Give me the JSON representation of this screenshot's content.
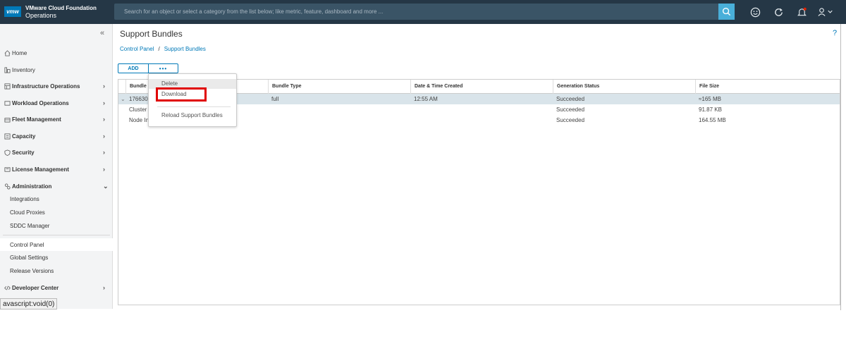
{
  "header": {
    "logo_text": "vmw",
    "brand_line1": "VMware Cloud Foundation",
    "brand_line2": "Operations",
    "search_placeholder": "Search for an object or select a category from the list below; like metric, feature, dashboard and more ...",
    "bg_color": "#253746",
    "accent_color": "#49afd9",
    "icons": [
      "search-icon",
      "smiley-icon",
      "refresh-icon",
      "bell-icon",
      "user-icon"
    ]
  },
  "sidebar": {
    "collapse_glyph": "«",
    "items": [
      {
        "label": "Home",
        "icon": "home-icon",
        "bold": false,
        "chevron": ""
      },
      {
        "label": "Inventory",
        "icon": "inventory-icon",
        "bold": false,
        "chevron": ""
      },
      {
        "label": "Infrastructure Operations",
        "icon": "infrastructure-icon",
        "bold": true,
        "chevron": "›"
      },
      {
        "label": "Workload Operations",
        "icon": "workload-icon",
        "bold": true,
        "chevron": "›"
      },
      {
        "label": "Fleet Management",
        "icon": "fleet-icon",
        "bold": true,
        "chevron": "›"
      },
      {
        "label": "Capacity",
        "icon": "capacity-icon",
        "bold": true,
        "chevron": "›"
      },
      {
        "label": "Security",
        "icon": "security-icon",
        "bold": true,
        "chevron": "›"
      },
      {
        "label": "License Management",
        "icon": "license-icon",
        "bold": true,
        "chevron": "›"
      },
      {
        "label": "Administration",
        "icon": "administration-icon",
        "bold": true,
        "chevron": "⌄"
      }
    ],
    "admin_sub": [
      "Integrations",
      "Cloud Proxies",
      "SDDC Manager"
    ],
    "admin_sub2": [
      "Control Panel",
      "Global Settings",
      "Release Versions"
    ],
    "developer": {
      "label": "Developer Center",
      "chevron": "›"
    },
    "status_text": "avascript:void(0)"
  },
  "main": {
    "title": "Support Bundles",
    "help": "?",
    "breadcrumb": {
      "root": "Control Panel",
      "sep": "/",
      "current": "Support Bundles"
    },
    "add_label": "ADD",
    "more_label": "•••",
    "columns": [
      "Bundle",
      "Bundle Type",
      "Date & Time Created",
      "Generation Status",
      "File Size"
    ],
    "rows": [
      {
        "expander": "⌄",
        "bundle": "176630",
        "type": "full",
        "date": "12:55 AM",
        "status": "Succeeded",
        "size": "≈165 MB"
      },
      {
        "expander": "",
        "bundle": "Cluster",
        "type": "",
        "date": "",
        "status": "Succeeded",
        "size": "91.87 KB"
      },
      {
        "expander": "",
        "bundle": "Node In",
        "type": "",
        "date": "",
        "status": "Succeeded",
        "size": "164.55 MB"
      }
    ],
    "menu": {
      "delete": "Delete",
      "download": "Download",
      "reload": "Reload Support Bundles"
    }
  }
}
